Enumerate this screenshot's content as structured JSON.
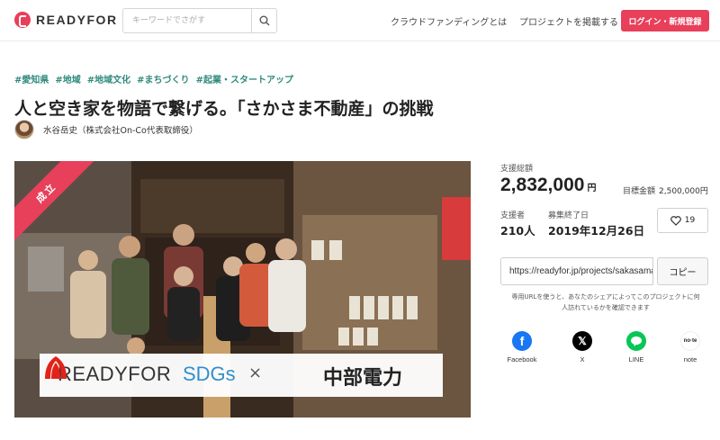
{
  "header": {
    "logo_text": "READYFOR",
    "search_placeholder": "キーワードでさがす",
    "nav": [
      "クラウドファンディングとは",
      "プロジェクトを掲載する"
    ],
    "login_label": "ログイン・新規登録"
  },
  "project": {
    "tags": [
      "#愛知県",
      "#地域",
      "#地域文化",
      "#まちづくり",
      "#起業・スタートアップ"
    ],
    "title": "人と空き家を物語で繋げる。「さかさま不動産」の挑戦",
    "owner": "水谷岳史（株式会社On-Co代表取締役）",
    "badge": "成立",
    "banner": {
      "readyfor": "READYFOR",
      "sdgs": "SDGs",
      "cross": "×",
      "partner": "中部電力"
    }
  },
  "stats": {
    "total_label": "支援総額",
    "total_value": "2,832,000",
    "total_unit": "円",
    "goal_label": "目標金額",
    "goal_value": "2,500,000円",
    "supporters_label": "支援者",
    "supporters_value": "210人",
    "end_label": "募集終了日",
    "end_value": "2019年12月26日",
    "favorites": "19"
  },
  "share": {
    "url": "https://readyfor.jp/projects/sakasama",
    "copy_label": "コピー",
    "note": "専用URLを使うと、あなたのシェアによってこのプロジェクトに何人訪れているかを確認できます",
    "services": [
      {
        "name": "Facebook",
        "color": "#1877f2"
      },
      {
        "name": "X",
        "color": "#000000"
      },
      {
        "name": "LINE",
        "color": "#06c755"
      },
      {
        "name": "note",
        "color": "#ffffff"
      }
    ]
  },
  "colors": {
    "accent": "#e83f5b",
    "tag": "#2f8a7b"
  }
}
